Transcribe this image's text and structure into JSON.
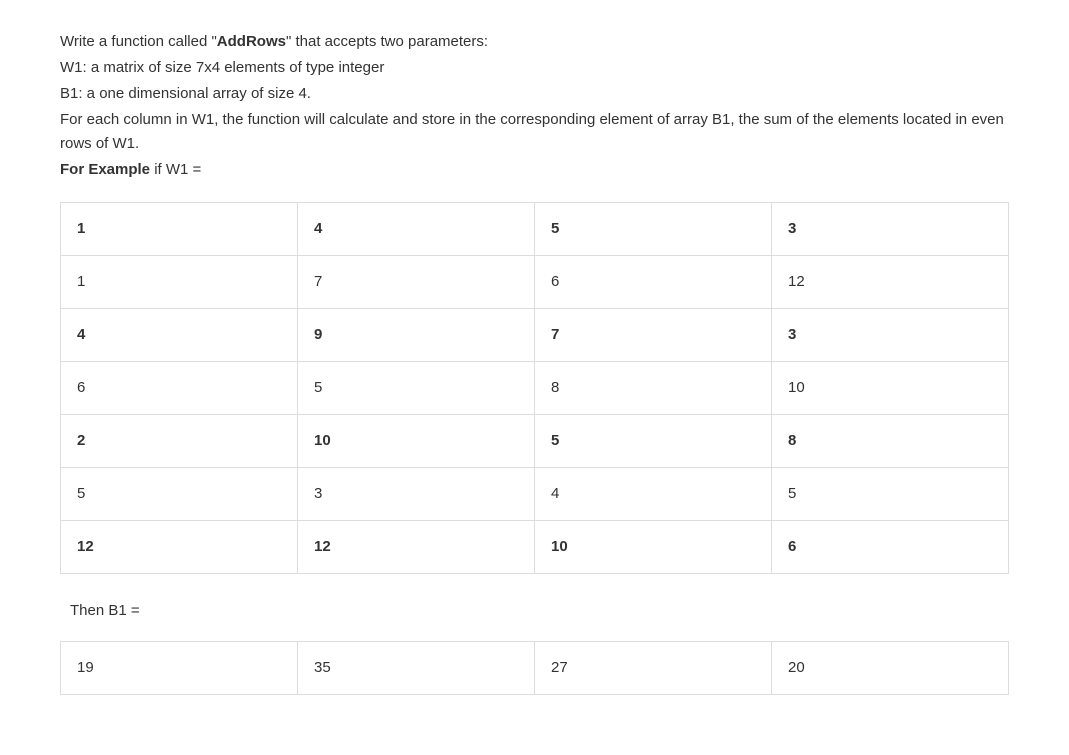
{
  "problem": {
    "line1_prefix": "Write a function called \"",
    "line1_bold": "AddRows",
    "line1_suffix": "\" that accepts two parameters:",
    "line2": "W1: a matrix of size 7x4 elements of type integer",
    "line3": "B1: a one dimensional array of size 4.",
    "line4": "For each column in W1, the function will calculate and store in the corresponding element of array B1, the sum of the elements located in even rows of W1.",
    "line5_bold": "For Example",
    "line5_suffix": " if W1 ="
  },
  "chart_data": {
    "type": "table",
    "W1": [
      [
        1,
        4,
        5,
        3
      ],
      [
        1,
        7,
        6,
        12
      ],
      [
        4,
        9,
        7,
        3
      ],
      [
        6,
        5,
        8,
        10
      ],
      [
        2,
        10,
        5,
        8
      ],
      [
        5,
        3,
        4,
        5
      ],
      [
        12,
        12,
        10,
        6
      ]
    ],
    "W1_bold_rows": [
      true,
      false,
      true,
      false,
      true,
      false,
      true
    ],
    "B1": [
      19,
      35,
      27,
      20
    ]
  },
  "then_label": "Then B1 ="
}
